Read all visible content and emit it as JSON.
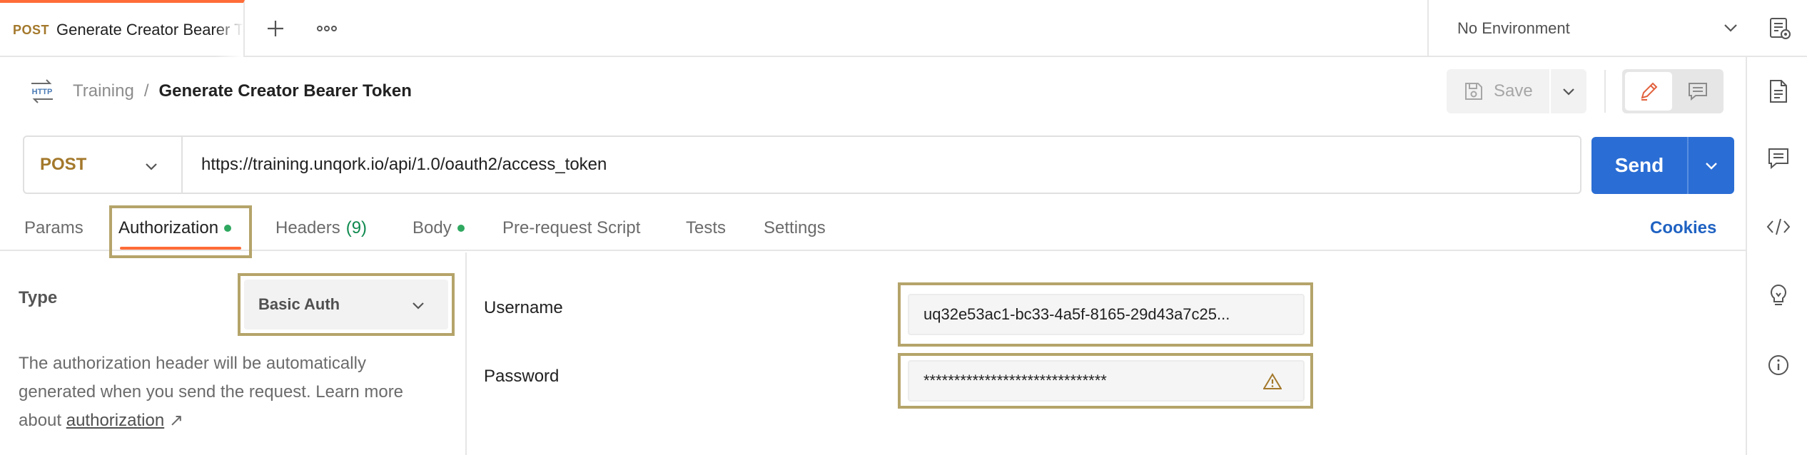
{
  "tab": {
    "method": "POST",
    "title": "Generate Creator Bearer Token"
  },
  "environment": {
    "label": "No Environment"
  },
  "breadcrumb": {
    "collection": "Training",
    "separator": "/",
    "request": "Generate Creator Bearer Token"
  },
  "toolbar": {
    "save_label": "Save"
  },
  "request": {
    "method": "POST",
    "url": "https://training.unqork.io/api/1.0/oauth2/access_token",
    "send_label": "Send"
  },
  "tabs": [
    {
      "label": "Params"
    },
    {
      "label": "Authorization"
    },
    {
      "label": "Headers",
      "count": "(9)"
    },
    {
      "label": "Body"
    },
    {
      "label": "Pre-request Script"
    },
    {
      "label": "Tests"
    },
    {
      "label": "Settings"
    }
  ],
  "cookies_label": "Cookies",
  "auth": {
    "type_label": "Type",
    "type_value": "Basic Auth",
    "description_pre": "The authorization header will be automatically generated when you send the request. Learn more about ",
    "description_link": "authorization",
    "description_arrow": "↗",
    "username_label": "Username",
    "username_value": "uq32e53ac1-bc33-4a5f-8165-29d43a7c25...",
    "password_label": "Password",
    "password_value": "******************************"
  },
  "colors": {
    "accent": "#ff6c37",
    "send": "#2a6dd4",
    "method": "#a3782b",
    "status_dot": "#2fa860",
    "highlight": "#b5a46a",
    "link": "#1f62c2"
  },
  "icons": [
    "plus-icon",
    "more-icon",
    "chevron-down-icon",
    "environment-eye-icon",
    "http-icon",
    "save-icon",
    "pencil-icon",
    "comment-icon",
    "document-icon",
    "code-icon",
    "lightbulb-icon",
    "info-icon",
    "warning-icon"
  ]
}
